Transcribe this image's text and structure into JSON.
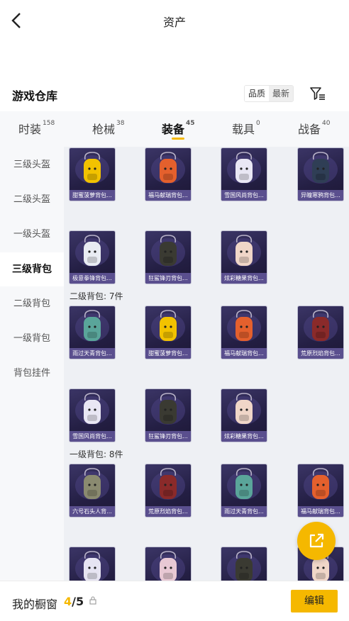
{
  "header": {
    "title": "资产"
  },
  "warehouse": {
    "title": "游戏仓库",
    "sort_options": [
      "品质",
      "最新"
    ]
  },
  "tabs": [
    {
      "label": "时装",
      "count": "158"
    },
    {
      "label": "枪械",
      "count": "38"
    },
    {
      "label": "装备",
      "count": "45"
    },
    {
      "label": "载具",
      "count": "0"
    },
    {
      "label": "战备",
      "count": "40"
    }
  ],
  "sidebar": {
    "items": [
      "三级头盔",
      "二级头盔",
      "一级头盔",
      "三级背包",
      "二级背包",
      "一级背包",
      "背包挂件"
    ],
    "active_index": 3
  },
  "sections": [
    {
      "title": "",
      "items": [
        {
          "name": "甜蜜菠萝背包...",
          "icon": "pineapple-backpack-icon",
          "color": "#f2c200"
        },
        {
          "name": "福马献瑞背包...",
          "icon": "horse-backpack-icon",
          "color": "#e4602d"
        },
        {
          "name": "雪国风尚背包...",
          "icon": "snow-backpack-icon",
          "color": "#e9e7f4"
        },
        {
          "name": "异瞳寒鸦背包...",
          "icon": "rabbit-backpack-icon",
          "color": "#2f3e55"
        },
        {
          "name": "极意拳锋背包...",
          "icon": "fist-backpack-icon",
          "color": "#e9ecf3"
        },
        {
          "name": "狂鲨锋刃背包...",
          "icon": "shark-backpack-icon",
          "color": "#3a3a32"
        },
        {
          "name": "炫彩糖果背包...",
          "icon": "donut-backpack-icon",
          "color": "#f0d6c8"
        }
      ]
    },
    {
      "title": "二级背包: 7件",
      "items": [
        {
          "name": "雨过天青背包...",
          "icon": "bird-backpack-icon",
          "color": "#5aa59a"
        },
        {
          "name": "甜蜜菠萝背包...",
          "icon": "pineapple-backpack-icon",
          "color": "#f2c200"
        },
        {
          "name": "福马献瑞背包...",
          "icon": "horse-backpack-icon",
          "color": "#e4602d"
        },
        {
          "name": "荒原烈焰背包...",
          "icon": "flame-backpack-icon",
          "color": "#8a2a2a"
        },
        {
          "name": "雪国风尚背包...",
          "icon": "snow-backpack-icon",
          "color": "#e9e7f4"
        },
        {
          "name": "狂鲨锋刃背包...",
          "icon": "shark-backpack-icon",
          "color": "#3a3a32"
        },
        {
          "name": "炫彩糖果背包...",
          "icon": "donut-backpack-icon",
          "color": "#f0d6c8"
        }
      ]
    },
    {
      "title": "一级背包: 8件",
      "items": [
        {
          "name": "六号石头人背...",
          "icon": "stone-backpack-icon",
          "color": "#8a8a70"
        },
        {
          "name": "荒原烈焰背包...",
          "icon": "flame-backpack-icon",
          "color": "#8a2a2a"
        },
        {
          "name": "雨过天青背包...",
          "icon": "bird-backpack-icon",
          "color": "#5aa59a"
        },
        {
          "name": "福马献瑞背包...",
          "icon": "horse-backpack-icon",
          "color": "#e4602d"
        },
        {
          "name": "",
          "icon": "bunny-backpack-icon",
          "color": "#e6e4f2"
        },
        {
          "name": "",
          "icon": "drink-backpack-icon",
          "color": "#e8c8d4"
        },
        {
          "name": "",
          "icon": "shark-backpack-icon",
          "color": "#3a3a32"
        },
        {
          "name": "",
          "icon": "donut-backpack-icon",
          "color": "#f0d6c8"
        }
      ]
    }
  ],
  "bottom": {
    "label": "我的橱窗",
    "count_current": "4",
    "count_total": "/5",
    "edit_label": "编辑"
  },
  "colors": {
    "accent": "#f5b800",
    "card_bg": "#2a2450",
    "card_caption": "#5a4f8e"
  }
}
